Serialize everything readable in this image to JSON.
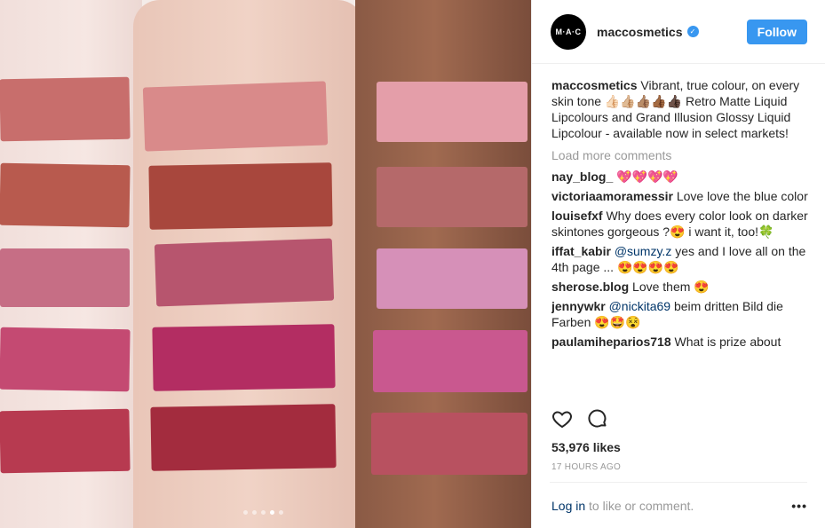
{
  "post": {
    "username": "maccosmetics",
    "avatar_text": "M·A·C",
    "verified_mark": "✓",
    "follow_label": "Follow",
    "caption_text": "Vibrant, true colour, on every skin tone 👍🏻👍🏼👍🏽👍🏾👍🏿 Retro Matte Liquid Lipcolours and Grand Illusion Glossy Liquid Lipcolour - available now in select markets!",
    "load_more": "Load more comments",
    "comments": [
      {
        "user": "nay_blog_",
        "text": " 💖💖💖💖"
      },
      {
        "user": "victoriaamoramessir",
        "text": " Love love the blue color"
      },
      {
        "user": "louisefxf",
        "text": " Why does every color look on darker skintones gorgeous ?😍 i want it, too!🍀"
      },
      {
        "user": "iffat_kabir",
        "mention": "@sumzy.z",
        "text": " yes and I love all on the 4th page ... 😍😍😍😍"
      },
      {
        "user": "sherose.blog",
        "text": " Love them 😍"
      },
      {
        "user": "jennywkr",
        "mention": "@nickita69",
        "text": " beim dritten Bild die Farben 😍🤩😵"
      },
      {
        "user": "paulamiheparios718",
        "text": " What is prize about"
      }
    ],
    "likes": "53,976 likes",
    "time": "17 HOURS AGO",
    "login_label": "Log in",
    "login_rest": " to like or comment.",
    "more_label": "•••"
  },
  "icons": {
    "like": "heart-outline-icon",
    "comment": "speech-bubble-icon"
  },
  "carousel": {
    "dots": 5,
    "active_index": 3
  },
  "colors": {
    "follow_blue": "#3897f0",
    "link_blue": "#003569"
  }
}
